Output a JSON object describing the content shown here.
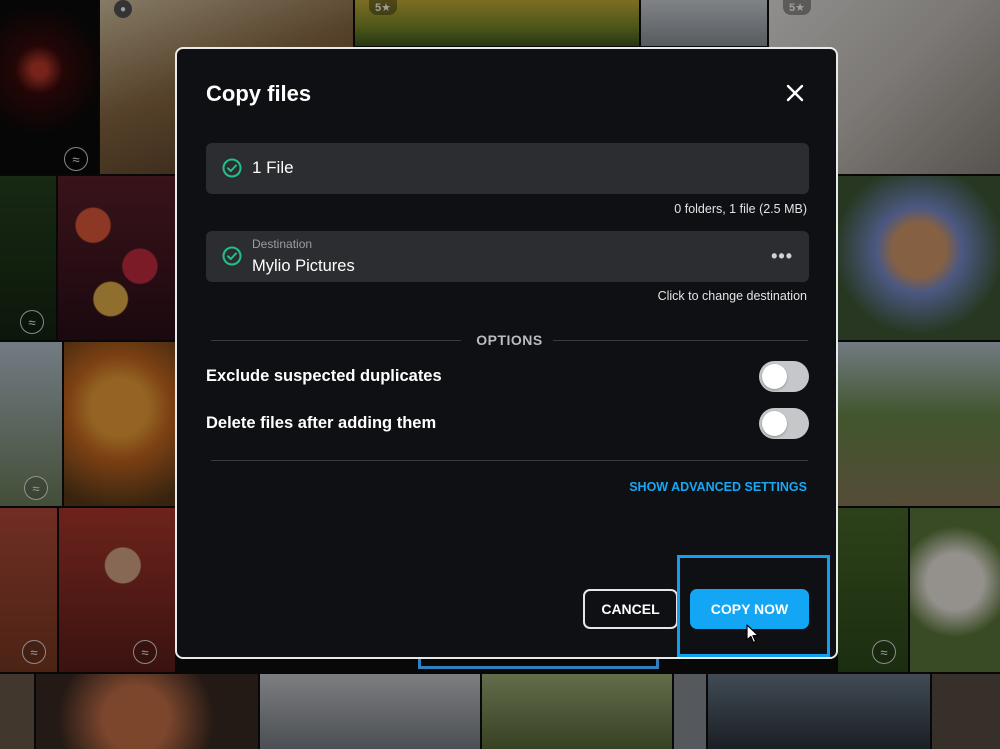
{
  "dialog": {
    "title": "Copy files",
    "files_label": "1 File",
    "files_summary": "0 folders, 1 file (2.5 MB)",
    "destination_caption": "Destination",
    "destination_value": "Mylio Pictures",
    "destination_more": "•••",
    "destination_hint": "Click to change destination",
    "options_heading": "OPTIONS",
    "toggles": [
      {
        "label": "Exclude suspected duplicates",
        "on": false
      },
      {
        "label": "Delete files after adding them",
        "on": false
      }
    ],
    "advanced_link": "SHOW ADVANCED SETTINGS",
    "cancel_label": "CANCEL",
    "copy_label": "COPY NOW"
  },
  "background": {
    "ratings": [
      "5★",
      "5★"
    ],
    "badge_glyph": "≈"
  },
  "colors": {
    "accent": "#13a6f4",
    "dialog_bg": "#0f1013",
    "field_bg": "#2b2d31",
    "check_green": "#22c18a"
  },
  "icons": [
    "close-icon",
    "check-circle-icon",
    "more-horizontal-icon",
    "mouse-pointer-icon",
    "location-pin-icon"
  ]
}
